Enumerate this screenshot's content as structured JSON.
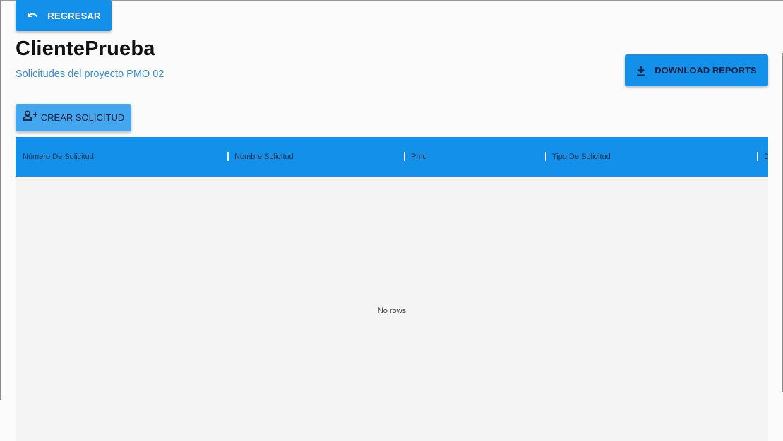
{
  "header": {
    "back_label": "REGRESAR",
    "title": "ClientePrueba",
    "subtitle": "Solicitudes del proyecto PMO 02",
    "download_label": "DOWNLOAD REPORTS"
  },
  "actions": {
    "create_label": "CREAR SOLICITUD"
  },
  "table": {
    "columns": [
      "Número De Solicitud",
      "Nombre Solicitud",
      "Pmo",
      "Tipo De Solicitud",
      "D"
    ],
    "rows": [],
    "empty_text": "No rows"
  },
  "icons": {
    "back": "undo-icon",
    "download": "download-icon",
    "create": "person-add-icon"
  },
  "colors": {
    "primary": "#1390ea",
    "create_button": "#43a6ef",
    "subtitle": "#3a8fd8",
    "table_body": "#f4f4f4"
  }
}
